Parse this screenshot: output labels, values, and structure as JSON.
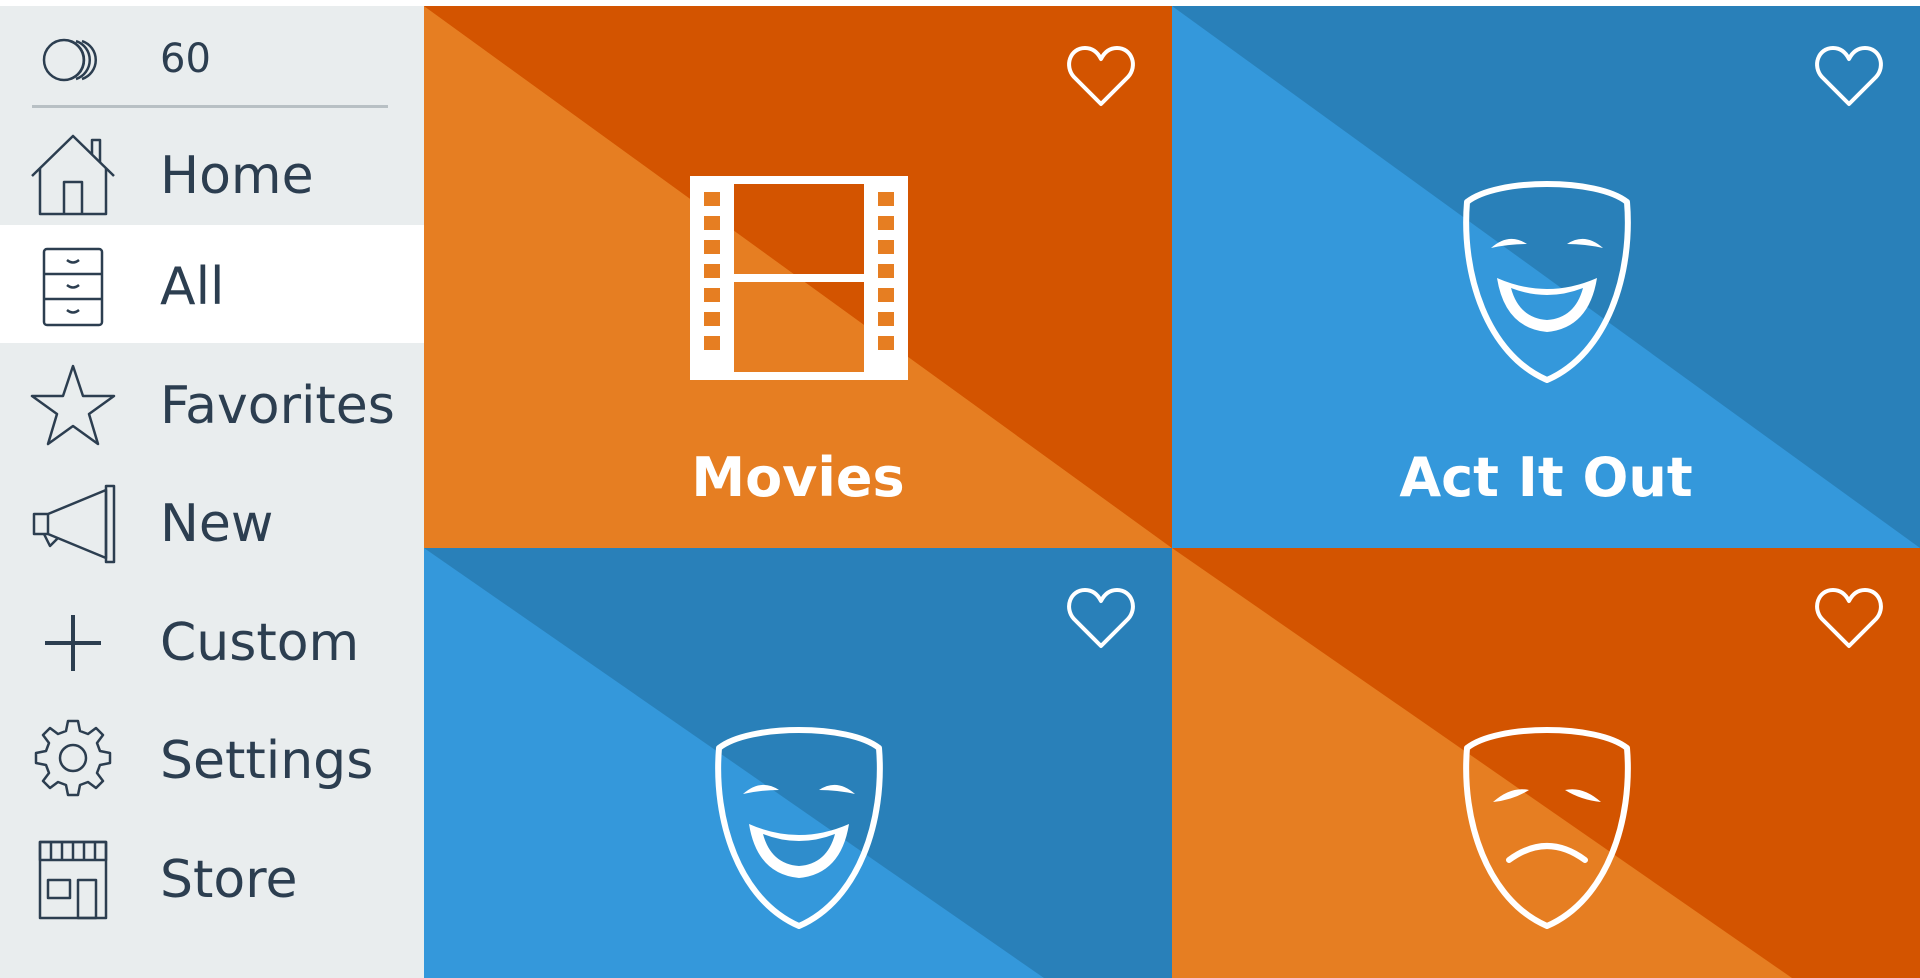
{
  "coins": {
    "count": "60",
    "icon": "coins-icon"
  },
  "sidebar": {
    "items": [
      {
        "label": "Home",
        "icon": "home-icon",
        "active": false
      },
      {
        "label": "All",
        "icon": "drawer-icon",
        "active": true
      },
      {
        "label": "Favorites",
        "icon": "star-icon",
        "active": false
      },
      {
        "label": "New",
        "icon": "megaphone-icon",
        "active": false
      },
      {
        "label": "Custom",
        "icon": "plus-icon",
        "active": false
      },
      {
        "label": "Settings",
        "icon": "gear-icon",
        "active": false
      },
      {
        "label": "Store",
        "icon": "store-icon",
        "active": false
      }
    ]
  },
  "tiles": [
    {
      "title": "Movies",
      "icon": "film-strip-icon",
      "theme": "orange",
      "favorite": false
    },
    {
      "title": "Act It Out",
      "icon": "comedy-mask-icon",
      "theme": "blue",
      "favorite": false
    },
    {
      "title": "",
      "icon": "comedy-mask-icon",
      "theme": "blue",
      "favorite": false
    },
    {
      "title": "",
      "icon": "tragedy-mask-icon",
      "theme": "orange",
      "favorite": false
    }
  ],
  "colors": {
    "sidebar_bg": "#e9edee",
    "active_item_bg": "#ffffff",
    "text": "#2c3e50",
    "orange_light": "#e67e22",
    "orange_dark": "#d35400",
    "blue_light": "#3498db",
    "blue_dark": "#2980b9"
  }
}
